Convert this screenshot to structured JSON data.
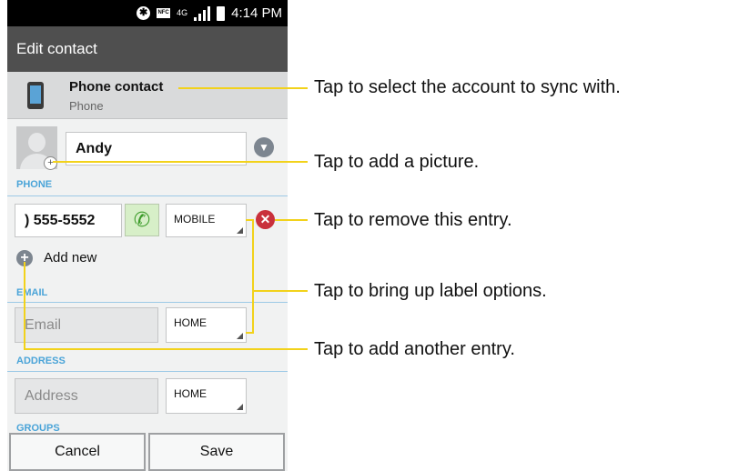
{
  "status_bar": {
    "time": "4:14 PM",
    "icons": [
      "bluetooth-icon",
      "nfc-icon",
      "lte-icon",
      "signal-icon",
      "battery-icon"
    ],
    "nfc_text": "NFC",
    "lte_text": "4G"
  },
  "header": {
    "title": "Edit contact"
  },
  "account": {
    "title": "Phone contact",
    "subtitle": "Phone"
  },
  "name": {
    "value": "Andy"
  },
  "sections": {
    "phone": "PHONE",
    "email": "EMAIL",
    "address": "ADDRESS",
    "groups": "GROUPS"
  },
  "phone_entry": {
    "value": ") 555-5552",
    "label": "MOBILE"
  },
  "add_new": {
    "label": "Add new"
  },
  "email_entry": {
    "placeholder": "Email",
    "label": "HOME"
  },
  "address_entry": {
    "placeholder": "Address",
    "label": "HOME"
  },
  "buttons": {
    "cancel": "Cancel",
    "save": "Save"
  },
  "callouts": [
    "Tap to select the account to sync with.",
    "Tap to add a picture.",
    "Tap to remove this entry.",
    "Tap to bring up label options.",
    "Tap to add another entry."
  ],
  "colors": {
    "section_label": "#4aa4d8",
    "callout_line": "#f2d21b",
    "remove": "#c9313c",
    "title_bar": "#4f4f4f"
  }
}
